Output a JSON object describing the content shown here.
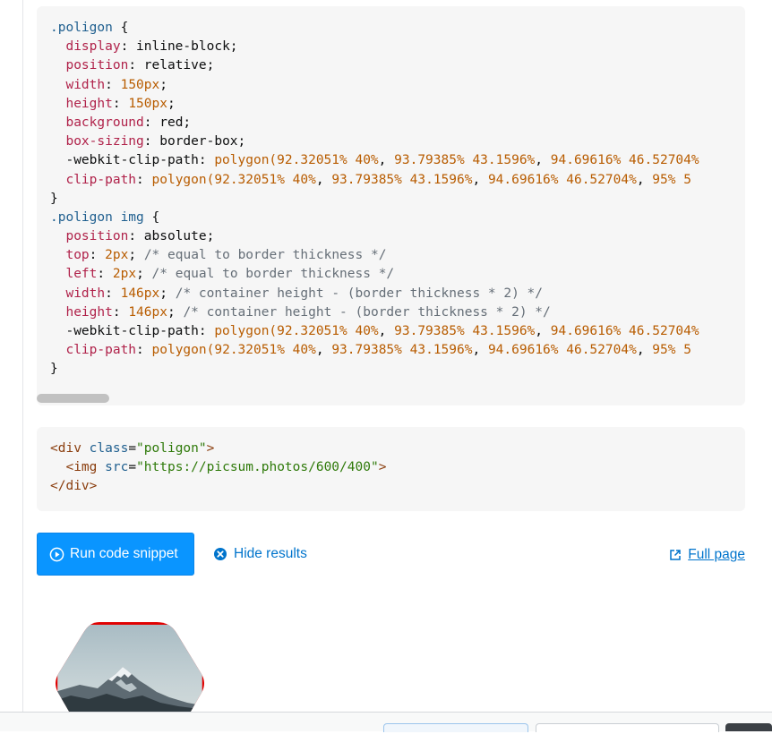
{
  "css_code": {
    "lines": [
      [
        {
          "c": "sel",
          "t": ".poligon"
        },
        {
          "c": "punc",
          "t": " {"
        }
      ],
      [
        {
          "c": "punc",
          "t": "  "
        },
        {
          "c": "prop",
          "t": "display"
        },
        {
          "c": "punc",
          "t": ": inline-block;"
        }
      ],
      [
        {
          "c": "punc",
          "t": "  "
        },
        {
          "c": "prop",
          "t": "position"
        },
        {
          "c": "punc",
          "t": ": relative;"
        }
      ],
      [
        {
          "c": "punc",
          "t": "  "
        },
        {
          "c": "prop",
          "t": "width"
        },
        {
          "c": "punc",
          "t": ": "
        },
        {
          "c": "num",
          "t": "150px"
        },
        {
          "c": "punc",
          "t": ";"
        }
      ],
      [
        {
          "c": "punc",
          "t": "  "
        },
        {
          "c": "prop",
          "t": "height"
        },
        {
          "c": "punc",
          "t": ": "
        },
        {
          "c": "num",
          "t": "150px"
        },
        {
          "c": "punc",
          "t": ";"
        }
      ],
      [
        {
          "c": "punc",
          "t": "  "
        },
        {
          "c": "prop",
          "t": "background"
        },
        {
          "c": "punc",
          "t": ": red;"
        }
      ],
      [
        {
          "c": "punc",
          "t": "  "
        },
        {
          "c": "prop",
          "t": "box-sizing"
        },
        {
          "c": "punc",
          "t": ": border-box;"
        }
      ],
      [
        {
          "c": "punc",
          "t": "  -webkit-clip-path: "
        },
        {
          "c": "fn",
          "t": "polygon("
        },
        {
          "c": "num",
          "t": "92.32051% 40%"
        },
        {
          "c": "punc",
          "t": ", "
        },
        {
          "c": "num",
          "t": "93.79385% 43.1596%"
        },
        {
          "c": "punc",
          "t": ", "
        },
        {
          "c": "num",
          "t": "94.69616% 46.52704%"
        }
      ],
      [
        {
          "c": "punc",
          "t": "  "
        },
        {
          "c": "prop",
          "t": "clip-path"
        },
        {
          "c": "punc",
          "t": ": "
        },
        {
          "c": "fn",
          "t": "polygon("
        },
        {
          "c": "num",
          "t": "92.32051% 40%"
        },
        {
          "c": "punc",
          "t": ", "
        },
        {
          "c": "num",
          "t": "93.79385% 43.1596%"
        },
        {
          "c": "punc",
          "t": ", "
        },
        {
          "c": "num",
          "t": "94.69616% 46.52704%"
        },
        {
          "c": "punc",
          "t": ", "
        },
        {
          "c": "num",
          "t": "95% 5"
        }
      ],
      [
        {
          "c": "punc",
          "t": "}"
        }
      ],
      [
        {
          "c": "sel",
          "t": ".poligon img"
        },
        {
          "c": "punc",
          "t": " {"
        }
      ],
      [
        {
          "c": "punc",
          "t": "  "
        },
        {
          "c": "prop",
          "t": "position"
        },
        {
          "c": "punc",
          "t": ": absolute;"
        }
      ],
      [
        {
          "c": "punc",
          "t": "  "
        },
        {
          "c": "prop",
          "t": "top"
        },
        {
          "c": "punc",
          "t": ": "
        },
        {
          "c": "num",
          "t": "2px"
        },
        {
          "c": "punc",
          "t": "; "
        },
        {
          "c": "cmt",
          "t": "/* equal to border thickness */"
        }
      ],
      [
        {
          "c": "punc",
          "t": "  "
        },
        {
          "c": "prop",
          "t": "left"
        },
        {
          "c": "punc",
          "t": ": "
        },
        {
          "c": "num",
          "t": "2px"
        },
        {
          "c": "punc",
          "t": "; "
        },
        {
          "c": "cmt",
          "t": "/* equal to border thickness */"
        }
      ],
      [
        {
          "c": "punc",
          "t": "  "
        },
        {
          "c": "prop",
          "t": "width"
        },
        {
          "c": "punc",
          "t": ": "
        },
        {
          "c": "num",
          "t": "146px"
        },
        {
          "c": "punc",
          "t": "; "
        },
        {
          "c": "cmt",
          "t": "/* container height - (border thickness * 2) */"
        }
      ],
      [
        {
          "c": "punc",
          "t": "  "
        },
        {
          "c": "prop",
          "t": "height"
        },
        {
          "c": "punc",
          "t": ": "
        },
        {
          "c": "num",
          "t": "146px"
        },
        {
          "c": "punc",
          "t": "; "
        },
        {
          "c": "cmt",
          "t": "/* container height - (border thickness * 2) */"
        }
      ],
      [
        {
          "c": "punc",
          "t": "  -webkit-clip-path: "
        },
        {
          "c": "fn",
          "t": "polygon("
        },
        {
          "c": "num",
          "t": "92.32051% 40%"
        },
        {
          "c": "punc",
          "t": ", "
        },
        {
          "c": "num",
          "t": "93.79385% 43.1596%"
        },
        {
          "c": "punc",
          "t": ", "
        },
        {
          "c": "num",
          "t": "94.69616% 46.52704%"
        }
      ],
      [
        {
          "c": "punc",
          "t": "  "
        },
        {
          "c": "prop",
          "t": "clip-path"
        },
        {
          "c": "punc",
          "t": ": "
        },
        {
          "c": "fn",
          "t": "polygon("
        },
        {
          "c": "num",
          "t": "92.32051% 40%"
        },
        {
          "c": "punc",
          "t": ", "
        },
        {
          "c": "num",
          "t": "93.79385% 43.1596%"
        },
        {
          "c": "punc",
          "t": ", "
        },
        {
          "c": "num",
          "t": "94.69616% 46.52704%"
        },
        {
          "c": "punc",
          "t": ", "
        },
        {
          "c": "num",
          "t": "95% 5"
        }
      ],
      [
        {
          "c": "punc",
          "t": "}"
        }
      ]
    ]
  },
  "html_code": {
    "lines": [
      [
        {
          "c": "tag",
          "t": "<div"
        },
        {
          "c": "punc",
          "t": " "
        },
        {
          "c": "attr",
          "t": "class"
        },
        {
          "c": "punc",
          "t": "="
        },
        {
          "c": "str",
          "t": "\"poligon\""
        },
        {
          "c": "tag",
          "t": ">"
        }
      ],
      [
        {
          "c": "punc",
          "t": "  "
        },
        {
          "c": "tag",
          "t": "<img"
        },
        {
          "c": "punc",
          "t": " "
        },
        {
          "c": "attr",
          "t": "src"
        },
        {
          "c": "punc",
          "t": "="
        },
        {
          "c": "str",
          "t": "\"https://picsum.photos/600/400\""
        },
        {
          "c": "tag",
          "t": ">"
        }
      ],
      [
        {
          "c": "tag",
          "t": "</div>"
        }
      ]
    ]
  },
  "snippet_controls": {
    "run_label": "Run code snippet",
    "hide_label": "Hide results",
    "full_page_label": "Full page"
  },
  "colors": {
    "run_button": "#0a95ff",
    "link": "#0074cc",
    "result_border": "#e00000"
  },
  "icons": {
    "run": "play-circle-icon",
    "hide": "close-circle-icon",
    "full_page": "external-link-icon"
  }
}
